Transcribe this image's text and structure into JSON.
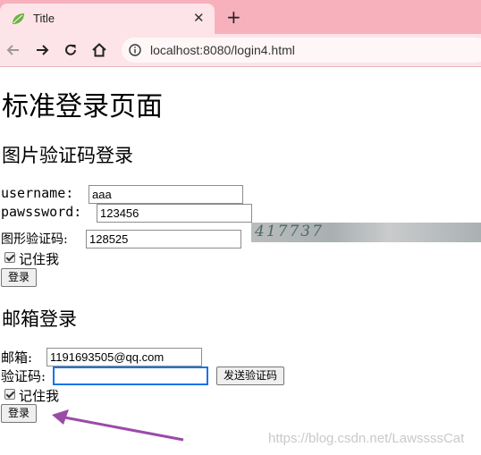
{
  "browser": {
    "tab_title": "Title",
    "tab_close": "✕",
    "new_tab": "+",
    "url": "localhost:8080/login4.html",
    "accent": "#f7b1bc"
  },
  "page": {
    "heading": "标准登录页面",
    "image_section": {
      "heading": "图片验证码登录",
      "username_label": "username:",
      "username_value": "aaa",
      "password_label": "pawssword:",
      "password_value": "123456",
      "captcha_label": "图形验证码:",
      "captcha_value": "128525",
      "captcha_image_text": "417737",
      "remember_label": "记住我",
      "remember_checked": true,
      "login_label": "登录"
    },
    "email_section": {
      "heading": "邮箱登录",
      "email_label": "邮箱:",
      "email_value": "1191693505@qq.com",
      "code_label": "验证码:",
      "code_value": "",
      "send_code_label": "发送验证码",
      "remember_label": "记住我",
      "remember_checked": true,
      "login_label": "登录"
    },
    "watermark": "https://blog.csdn.net/LawssssCat"
  }
}
